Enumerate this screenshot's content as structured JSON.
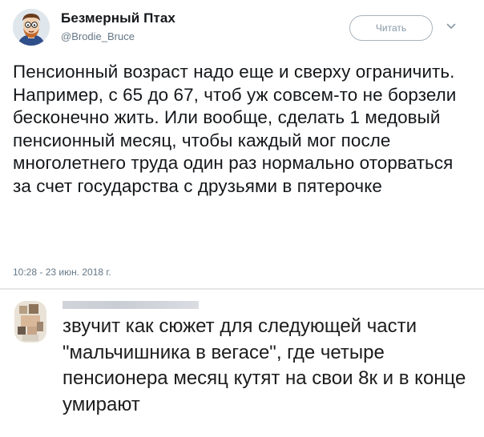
{
  "tweet": {
    "author": {
      "display_name": "Безмерный Птах",
      "handle": "@Brodie_Bruce",
      "avatar_icon": "avatar-cartoon-icon"
    },
    "follow_label": "Читать",
    "menu_icon": "chevron-down-icon",
    "text": "Пенсионный возраст надо еще и сверху ограничить. Например, с 65 до 67, чтоб уж совсем-то не борзели бесконечно жить. Или вообще, сделать 1 медовый пенсионный месяц, чтобы каждый мог после многолетнего труда один раз нормально оторваться за счет государства с друзьями в пятерочке",
    "timestamp": "10:28 - 23 июн. 2018 г."
  },
  "comment": {
    "avatar_icon": "blurred-avatar-icon",
    "text": "звучит как сюжет для следующей части \"мальчишника в вегасе\", где четыре пенсионера месяц кутят на свои 8к и в конце умирают"
  },
  "colors": {
    "text": "#14171a",
    "secondary": "#657786",
    "button_border": "#a9b4bd"
  }
}
